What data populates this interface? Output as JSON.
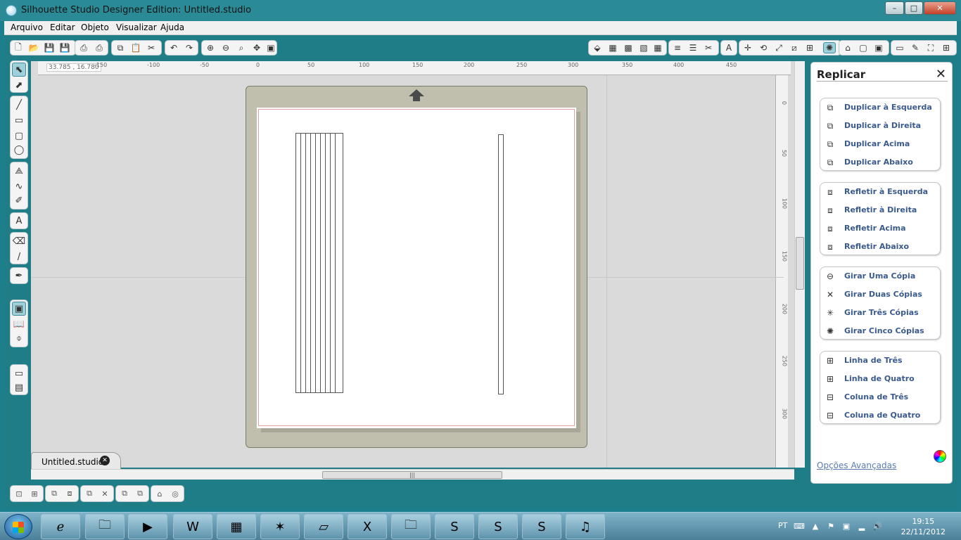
{
  "window": {
    "title": "Silhouette Studio Designer Edition: Untitled.studio",
    "minimize": "–",
    "maximize": "□",
    "close": "✕"
  },
  "menu": [
    "Arquivo",
    "Editar",
    "Objeto",
    "Visualizar",
    "Ajuda"
  ],
  "workspace": {
    "coords": "33.785 , 16.780",
    "hruler_ticks": [
      "-150",
      "-100",
      "-50",
      "0",
      "50",
      "100",
      "150",
      "200",
      "250",
      "300",
      "350",
      "400",
      "450"
    ],
    "vruler_ticks": [
      "0",
      "50",
      "100",
      "150",
      "200",
      "250",
      "300"
    ],
    "scroll_grip": "|||"
  },
  "tab": {
    "label": "Untitled.studio",
    "close": "✕"
  },
  "panel": {
    "title": "Replicar",
    "close": "✕",
    "groups": [
      {
        "items": [
          {
            "label": "Duplicar à Esquerda",
            "icon": "duplicate-left-icon"
          },
          {
            "label": "Duplicar à Direita",
            "icon": "duplicate-right-icon"
          },
          {
            "label": "Duplicar Acima",
            "icon": "duplicate-above-icon"
          },
          {
            "label": "Duplicar Abaixo",
            "icon": "duplicate-below-icon"
          }
        ]
      },
      {
        "items": [
          {
            "label": "Refletir à Esquerda",
            "icon": "mirror-left-icon"
          },
          {
            "label": "Refletir à Direita",
            "icon": "mirror-right-icon"
          },
          {
            "label": "Refletir Acima",
            "icon": "mirror-above-icon"
          },
          {
            "label": "Refletir Abaixo",
            "icon": "mirror-below-icon"
          }
        ]
      },
      {
        "items": [
          {
            "label": "Girar Uma Cópia",
            "icon": "rotate-one-icon"
          },
          {
            "label": "Girar Duas Cópias",
            "icon": "rotate-two-icon"
          },
          {
            "label": "Girar Três Cópias",
            "icon": "rotate-three-icon"
          },
          {
            "label": "Girar Cinco Cópias",
            "icon": "rotate-five-icon"
          }
        ]
      },
      {
        "items": [
          {
            "label": "Linha de Três",
            "icon": "row-three-icon"
          },
          {
            "label": "Linha de Quatro",
            "icon": "row-four-icon"
          },
          {
            "label": "Coluna de Três",
            "icon": "column-three-icon"
          },
          {
            "label": "Coluna de Quatro",
            "icon": "column-four-icon"
          }
        ]
      }
    ],
    "advanced_link": "Opções Avançadas"
  },
  "taskbar": {
    "language": "PT",
    "time": "19:15",
    "date": "22/11/2012",
    "apps": [
      "internet-explorer",
      "file-explorer",
      "media-player",
      "word",
      "calculator",
      "spider",
      "notepad",
      "excel",
      "file-manager",
      "sbx",
      "skype",
      "silhouette-studio",
      "itunes"
    ]
  },
  "colors": {
    "frame": "#1f7d88",
    "workspace": "#dadada",
    "mat": "#c0bfae",
    "accent": "#3a5a8c"
  }
}
